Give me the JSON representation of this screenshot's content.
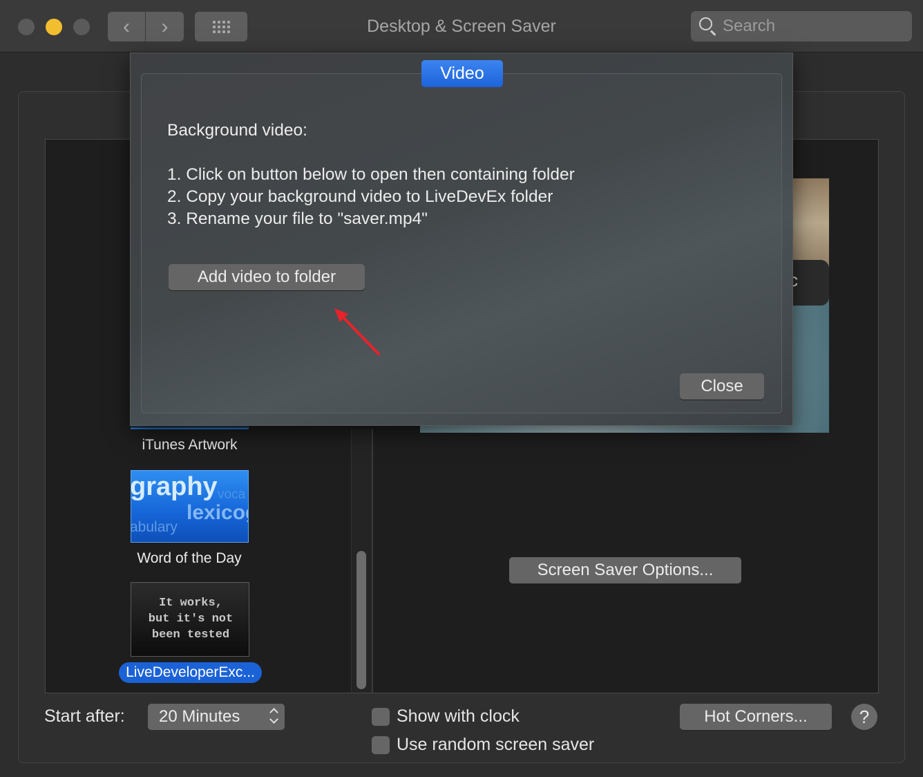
{
  "window": {
    "title": "Desktop & Screen Saver",
    "search_placeholder": "Search"
  },
  "icons": {
    "back": "chevron-left-icon",
    "forward": "chevron-right-icon",
    "grid": "grid-icon",
    "search": "search-icon",
    "help": "question-mark-icon"
  },
  "screensavers": {
    "items": [
      {
        "label": "iTunes Artwork"
      },
      {
        "label": "Word of the Day",
        "thumb_words": [
          "graphy",
          "voca",
          "lexicog",
          "abulary"
        ]
      },
      {
        "label": "LiveDeveloperExc...",
        "selected": true,
        "thumb_lines": [
          "It works,",
          "but it's not",
          "been tested"
        ]
      }
    ]
  },
  "preview": {
    "hover_text": "c"
  },
  "buttons": {
    "screen_saver_options": "Screen Saver Options...",
    "hot_corners": "Hot Corners...",
    "help": "?"
  },
  "footer": {
    "start_after_label": "Start after:",
    "start_after_value": "20 Minutes",
    "show_with_clock": "Show with clock",
    "use_random": "Use random screen saver",
    "show_with_clock_checked": false,
    "use_random_checked": false
  },
  "sheet": {
    "tab_label": "Video",
    "heading": "Background video:",
    "steps": [
      "1. Click on button below to open then containing folder",
      "2. Copy your background video to LiveDevEx folder",
      "3. Rename your file to \"saver.mp4\""
    ],
    "add_button": "Add video to folder",
    "close_button": "Close"
  },
  "colors": {
    "accent": "#1d63db",
    "traffic_minimize": "#f2be2f",
    "annotation_arrow": "#e8232a"
  }
}
